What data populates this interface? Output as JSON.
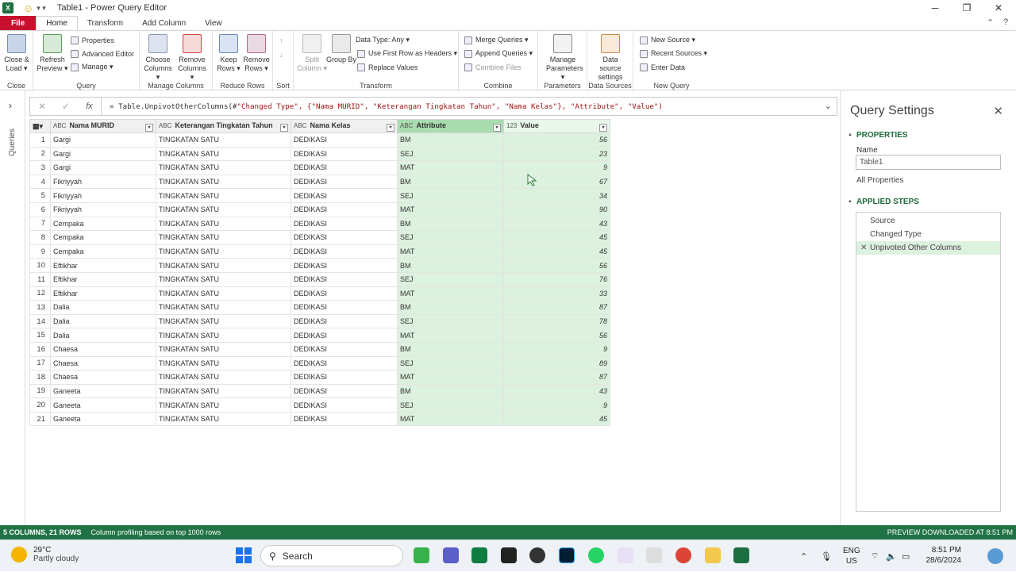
{
  "window": {
    "title": "Table1 - Power Query Editor",
    "app_icon": "X",
    "min": "─",
    "max": "❐",
    "close": "✕"
  },
  "tabs": [
    "File",
    "Home",
    "Transform",
    "Add Column",
    "View"
  ],
  "ribbon": {
    "close_group": {
      "btn": "Close & Load ▾",
      "label": "Close"
    },
    "query_group": {
      "refresh": "Refresh Preview ▾",
      "properties": "Properties",
      "advanced": "Advanced Editor",
      "manage": "Manage ▾",
      "label": "Query"
    },
    "manage_columns": {
      "choose": "Choose Columns ▾",
      "remove": "Remove Columns ▾",
      "label": "Manage Columns"
    },
    "reduce_rows": {
      "keep": "Keep Rows ▾",
      "remove": "Remove Rows ▾",
      "label": "Reduce Rows"
    },
    "sort": {
      "label": "Sort"
    },
    "transform": {
      "split": "Split Column ▾",
      "group": "Group By",
      "datatype": "Data Type: Any ▾",
      "first_row": "Use First Row as Headers ▾",
      "replace": "Replace Values",
      "label": "Transform"
    },
    "combine": {
      "merge": "Merge Queries ▾",
      "append": "Append Queries ▾",
      "combine_files": "Combine Files",
      "label": "Combine"
    },
    "parameters": {
      "manage": "Manage Parameters ▾",
      "label": "Parameters"
    },
    "data_sources": {
      "settings": "Data source settings",
      "label": "Data Sources"
    },
    "new_query": {
      "new_source": "New Source ▾",
      "recent": "Recent Sources ▾",
      "enter": "Enter Data",
      "label": "New Query"
    }
  },
  "left_pane": {
    "label": "Queries",
    "chevron": "›"
  },
  "formula_bar": {
    "cancel": "✕",
    "commit": "✓",
    "fx": "fx",
    "prefix": "= Table.UnpivotOtherColumns(#",
    "text": "\"Changed Type\", {\"Nama MURID\", \"Keterangan Tingkatan Tahun\", \"Nama Kelas\"}, \"Attribute\", \"Value\")"
  },
  "grid": {
    "columns": [
      {
        "type": "ABC",
        "name": "Nama MURID"
      },
      {
        "type": "ABC",
        "name": "Keterangan Tingkatan Tahun"
      },
      {
        "type": "ABC",
        "name": "Nama Kelas"
      },
      {
        "type": "ABC",
        "name": "Attribute"
      },
      {
        "type": "123",
        "name": "Value"
      }
    ],
    "rows": [
      [
        "1",
        "Gargi",
        "TINGKATAN SATU",
        "DEDIKASI",
        "BM",
        "56"
      ],
      [
        "2",
        "Gargi",
        "TINGKATAN SATU",
        "DEDIKASI",
        "SEJ",
        "23"
      ],
      [
        "3",
        "Gargi",
        "TINGKATAN SATU",
        "DEDIKASI",
        "MAT",
        "9"
      ],
      [
        "4",
        "Fikriyyah",
        "TINGKATAN SATU",
        "DEDIKASI",
        "BM",
        "67"
      ],
      [
        "5",
        "Fikriyyah",
        "TINGKATAN SATU",
        "DEDIKASI",
        "SEJ",
        "34"
      ],
      [
        "6",
        "Fikriyyah",
        "TINGKATAN SATU",
        "DEDIKASI",
        "MAT",
        "90"
      ],
      [
        "7",
        "Cempaka",
        "TINGKATAN SATU",
        "DEDIKASI",
        "BM",
        "43"
      ],
      [
        "8",
        "Cempaka",
        "TINGKATAN SATU",
        "DEDIKASI",
        "SEJ",
        "45"
      ],
      [
        "9",
        "Cempaka",
        "TINGKATAN SATU",
        "DEDIKASI",
        "MAT",
        "45"
      ],
      [
        "10",
        "Eftikhar",
        "TINGKATAN SATU",
        "DEDIKASI",
        "BM",
        "56"
      ],
      [
        "11",
        "Eftikhar",
        "TINGKATAN SATU",
        "DEDIKASI",
        "SEJ",
        "76"
      ],
      [
        "12",
        "Eftikhar",
        "TINGKATAN SATU",
        "DEDIKASI",
        "MAT",
        "33"
      ],
      [
        "13",
        "Dalia",
        "TINGKATAN SATU",
        "DEDIKASI",
        "BM",
        "87"
      ],
      [
        "14",
        "Dalia",
        "TINGKATAN SATU",
        "DEDIKASI",
        "SEJ",
        "78"
      ],
      [
        "15",
        "Dalia",
        "TINGKATAN SATU",
        "DEDIKASI",
        "MAT",
        "56"
      ],
      [
        "16",
        "Chaesa",
        "TINGKATAN SATU",
        "DEDIKASI",
        "BM",
        "9"
      ],
      [
        "17",
        "Chaesa",
        "TINGKATAN SATU",
        "DEDIKASI",
        "SEJ",
        "89"
      ],
      [
        "18",
        "Chaesa",
        "TINGKATAN SATU",
        "DEDIKASI",
        "MAT",
        "87"
      ],
      [
        "19",
        "Ganeeta",
        "TINGKATAN SATU",
        "DEDIKASI",
        "BM",
        "43"
      ],
      [
        "20",
        "Ganeeta",
        "TINGKATAN SATU",
        "DEDIKASI",
        "SEJ",
        "9"
      ],
      [
        "21",
        "Ganeeta",
        "TINGKATAN SATU",
        "DEDIKASI",
        "MAT",
        "45"
      ]
    ]
  },
  "settings": {
    "title": "Query Settings",
    "close": "✕",
    "properties_header": "PROPERTIES",
    "name_label": "Name",
    "name_value": "Table1",
    "all_properties": "All Properties",
    "steps_header": "APPLIED STEPS",
    "steps": [
      "Source",
      "Changed Type",
      "Unpivoted Other Columns"
    ]
  },
  "status": {
    "columns_rows": "5 COLUMNS, 21 ROWS",
    "profiling": "Column profiling based on top 1000 rows",
    "preview": "PREVIEW DOWNLOADED AT 8:51 PM"
  },
  "taskbar": {
    "temp": "29°C",
    "weather": "Partly cloudy",
    "search": "Search",
    "lang1": "ENG",
    "lang2": "US",
    "time": "8:51 PM",
    "date": "28/6/2024"
  },
  "colors": {
    "accent_green": "#217346",
    "file_tab": "#c8102e",
    "selected_col": "#dcf1de"
  }
}
